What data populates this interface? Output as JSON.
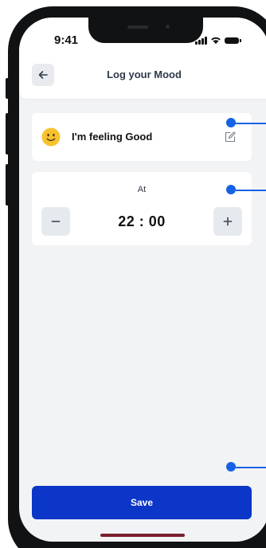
{
  "status_bar": {
    "time": "9:41"
  },
  "header": {
    "title": "Log your Mood",
    "back_icon": "arrow-left-icon"
  },
  "mood": {
    "emoji": "slightly-smiling-face-icon",
    "text": "I'm feeling Good",
    "edit_icon": "edit-icon"
  },
  "time_picker": {
    "label": "At",
    "value": "22 : 00",
    "decrement_icon": "minus-icon",
    "increment_icon": "plus-icon"
  },
  "actions": {
    "save_label": "Save"
  },
  "colors": {
    "primary": "#0b36c7",
    "annotation": "#1662e6",
    "background": "#f2f3f5"
  }
}
